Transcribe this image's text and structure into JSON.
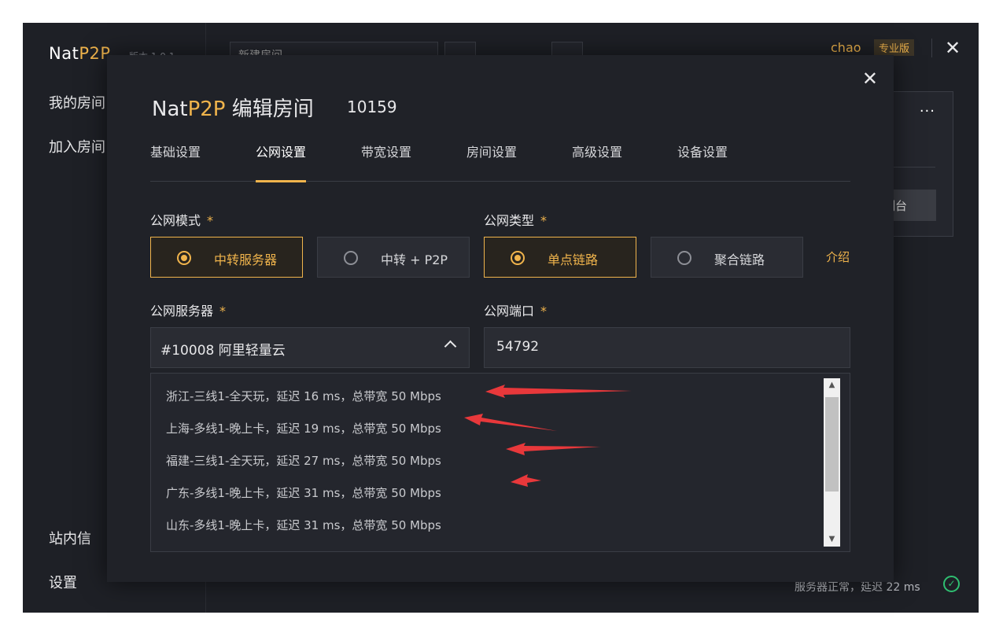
{
  "app": {
    "logo_prefix": "Nat",
    "logo_accent": "P2P",
    "version": "版本 1.0.1",
    "sidebar": {
      "my_rooms": "我的房间",
      "join_room": "加入房间",
      "messages": "站内信",
      "settings": "设置"
    },
    "topbar": {
      "search_value": "新建房间"
    },
    "user": {
      "name": "chao",
      "plan": "专业版"
    },
    "card": {
      "more": "···",
      "button": "控制台"
    },
    "status": {
      "text": "服务器正常，延迟 22 ms"
    }
  },
  "modal": {
    "title_prefix": "Nat",
    "title_accent": "P2P",
    "title_suffix": " 编辑房间",
    "room_id": "10159",
    "tabs": [
      "基础设置",
      "公网设置",
      "带宽设置",
      "房间设置",
      "高级设置",
      "设备设置"
    ],
    "active_tab": "公网设置",
    "public_mode": {
      "label": "公网模式",
      "required": "*",
      "options": [
        "中转服务器",
        "中转 + P2P"
      ],
      "selected": "中转服务器"
    },
    "public_type": {
      "label": "公网类型",
      "required": "*",
      "options": [
        "单点链路",
        "聚合链路"
      ],
      "selected": "单点链路",
      "intro_link": "介绍"
    },
    "public_server": {
      "label": "公网服务器",
      "required": "*",
      "value": "#10008 阿里轻量云",
      "options": [
        "浙江-三线1-全天玩，延迟 16 ms，总带宽 50 Mbps",
        "上海-多线1-晚上卡，延迟 19 ms，总带宽 50 Mbps",
        "福建-三线1-全天玩，延迟 27 ms，总带宽 50 Mbps",
        "广东-多线1-晚上卡，延迟 31 ms，总带宽 50 Mbps",
        "山东-多线1-晚上卡，延迟 31 ms，总带宽 50 Mbps"
      ]
    },
    "public_port": {
      "label": "公网端口",
      "required": "*",
      "value": "54792"
    }
  },
  "colors": {
    "accent": "#f0b44c",
    "annotation_arrow": "#e8383b",
    "status_ok": "#2fbf71"
  }
}
